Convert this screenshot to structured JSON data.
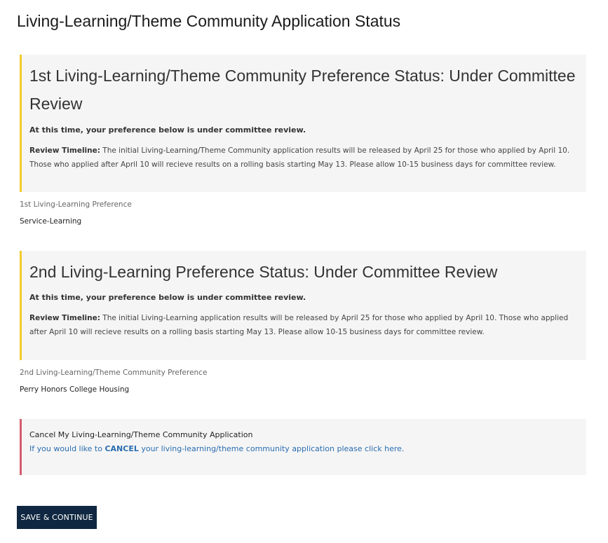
{
  "page": {
    "title": "Living-Learning/Theme Community Application Status"
  },
  "first_preference": {
    "heading": "1st Living-Learning/Theme Community Preference Status: Under Committee Review",
    "notice": "At this time, your preference below is under committee review.",
    "timeline_label": "Review Timeline:",
    "timeline_text": " The initial Living-Learning/Theme Community application results will be released by April 25 for those who applied by April 10. Those who applied after April 10 will recieve results on a rolling basis starting May 13. Please allow 10-15 business days for committee review.",
    "field_label": "1st Living-Learning Preference",
    "field_value": "Service-Learning",
    "accent_color": "#f2cb2c"
  },
  "second_preference": {
    "heading": "2nd Living-Learning Preference Status: Under Committee Review",
    "notice": "At this time, your preference below is under committee review.",
    "timeline_label": "Review Timeline:",
    "timeline_text": " The initial Living-Learning application results will be released by April 25 for those who applied by April 10. Those who applied after April 10 will recieve results on a rolling basis starting May 13. Please allow 10-15 business days for committee review.",
    "field_label": "2nd Living-Learning/Theme Community Preference",
    "field_value": "Perry Honors College Housing",
    "accent_color": "#f2cb2c"
  },
  "cancel": {
    "title": "Cancel My Living-Learning/Theme Community Application",
    "text_before": "If you would like to ",
    "text_strong": "CANCEL",
    "text_after": " your living-learning/theme community application please click here.",
    "accent_color": "#d55b6d",
    "link_color": "#2a6db0"
  },
  "actions": {
    "save_label": "SAVE & CONTINUE",
    "button_color": "#0f2740"
  }
}
